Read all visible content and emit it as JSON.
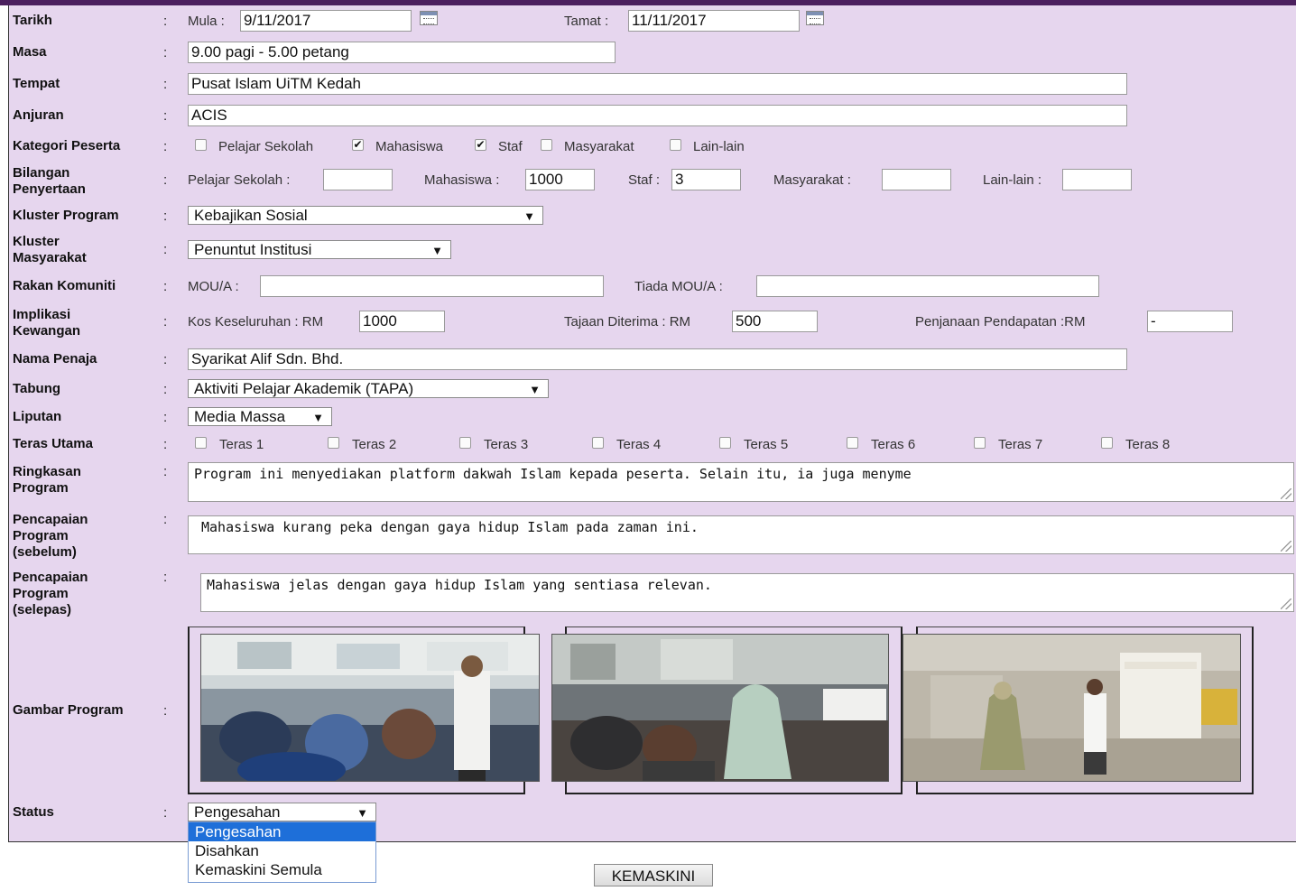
{
  "tarikh": {
    "label": "Tarikh",
    "mula_label": "Mula :",
    "mula_value": "9/11/2017",
    "tamat_label": "Tamat :",
    "tamat_value": "11/11/2017"
  },
  "masa": {
    "label": "Masa",
    "value": "9.00 pagi - 5.00 petang"
  },
  "tempat": {
    "label": "Tempat",
    "value": "Pusat Islam UiTM Kedah"
  },
  "anjuran": {
    "label": "Anjuran",
    "value": "ACIS"
  },
  "kategori": {
    "label": "Kategori Peserta",
    "options": [
      {
        "label": "Pelajar Sekolah",
        "checked": false
      },
      {
        "label": "Mahasiswa",
        "checked": true
      },
      {
        "label": "Staf",
        "checked": true
      },
      {
        "label": "Masyarakat",
        "checked": false
      },
      {
        "label": "Lain-lain",
        "checked": false
      }
    ]
  },
  "bilangan": {
    "label_1": "Bilangan",
    "label_2": "Penyertaan",
    "pelajar_label": "Pelajar Sekolah :",
    "pelajar_value": "",
    "mahasiswa_label": "Mahasiswa :",
    "mahasiswa_value": "1000",
    "staf_label": "Staf :",
    "staf_value": "3",
    "masyarakat_label": "Masyarakat :",
    "masyarakat_value": "",
    "lain_label": "Lain-lain :",
    "lain_value": ""
  },
  "kluster_program": {
    "label": "Kluster Program",
    "selected": "Kebajikan Sosial"
  },
  "kluster_masyarakat": {
    "label_1": "Kluster",
    "label_2": "Masyarakat",
    "selected": "Penuntut Institusi"
  },
  "rakan": {
    "label": "Rakan Komuniti",
    "mou_label": "MOU/A :",
    "mou_value": "",
    "tiada_label": "Tiada MOU/A :",
    "tiada_value": ""
  },
  "implikasi": {
    "label_1": "Implikasi",
    "label_2": "Kewangan",
    "kos_label": "Kos Keseluruhan : RM",
    "kos_value": "1000",
    "tajaan_label": "Tajaan Diterima : RM",
    "tajaan_value": "500",
    "penjanaan_label": "Penjanaan Pendapatan :RM",
    "penjanaan_value": "-"
  },
  "penaja": {
    "label": "Nama Penaja",
    "value": "Syarikat Alif Sdn. Bhd."
  },
  "tabung": {
    "label": "Tabung",
    "selected": "Aktiviti Pelajar Akademik (TAPA)"
  },
  "liputan": {
    "label": "Liputan",
    "selected": "Media Massa"
  },
  "teras": {
    "label": "Teras Utama",
    "items": [
      "Teras 1",
      "Teras 2",
      "Teras 3",
      "Teras 4",
      "Teras 5",
      "Teras 6",
      "Teras 7",
      "Teras 8"
    ]
  },
  "ringkasan": {
    "label_1": "Ringkasan",
    "label_2": "Program",
    "value": "Program ini menyediakan platform dakwah Islam kepada peserta. Selain itu, ia juga menyme"
  },
  "sebelum": {
    "label_1": "Pencapaian",
    "label_2": "Program",
    "label_3": "(sebelum)",
    "value": "Mahasiswa kurang peka dengan gaya hidup Islam pada zaman ini."
  },
  "selepas": {
    "label_1": "Pencapaian",
    "label_2": "Program",
    "label_3": "(selepas)",
    "value": "Mahasiswa jelas dengan gaya hidup Islam yang sentiasa relevan."
  },
  "gambar": {
    "label": "Gambar Program"
  },
  "status": {
    "label": "Status",
    "selected": "Pengesahan",
    "options": [
      "Pengesahan",
      "Disahkan",
      "Kemaskini Semula"
    ]
  },
  "submit": {
    "label": "KEMASKINI"
  },
  "colon": ":",
  "colors": {
    "panel": "#e6d6ee",
    "topbar": "#4b1f5e",
    "highlight": "#1e6fd9"
  }
}
